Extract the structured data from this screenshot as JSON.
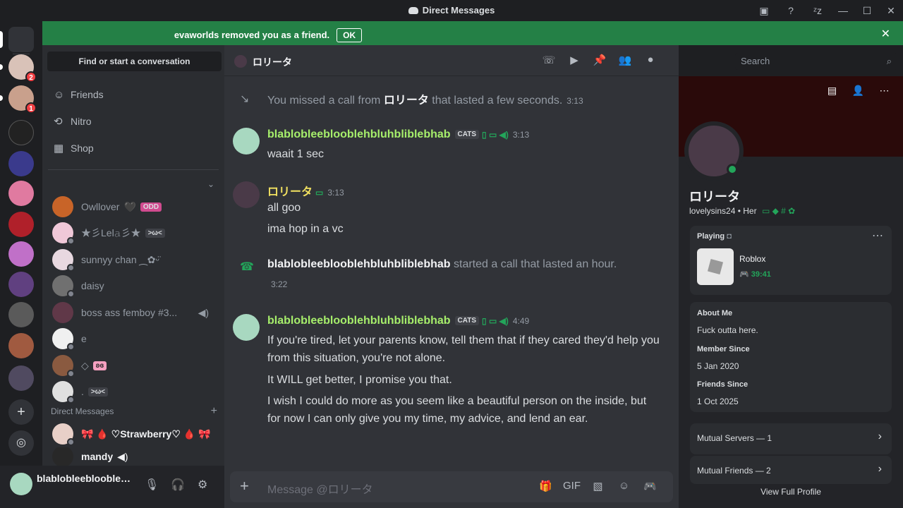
{
  "window": {
    "title": "Direct Messages",
    "controls": [
      "inbox-icon",
      "help-icon",
      "user-status-icon",
      "minimize-icon",
      "maximize-icon",
      "close-icon"
    ]
  },
  "banner": {
    "message": "evaworlds removed you as a friend.",
    "ok_label": "OK",
    "close_icon": "close-icon",
    "color": "#248046"
  },
  "server_rail": {
    "badges": [
      {
        "count": "2"
      },
      {
        "count": "1"
      }
    ]
  },
  "sidebar": {
    "find_label": "Find or start a conversation",
    "nav": [
      {
        "label": "Friends",
        "icon": "friends-icon"
      },
      {
        "label": "Nitro",
        "icon": "nitro-icon"
      },
      {
        "label": "Shop",
        "icon": "shop-icon"
      }
    ],
    "dms_top": [
      {
        "name": "Owllover",
        "extra": "🖤",
        "tag": "ODD"
      },
      {
        "name": "★彡Lel𝚊彡★",
        "extra": "",
        "tag": ">ω<"
      },
      {
        "name": "sunnyy chan ⁔✿ᵕ̈",
        "extra": "",
        "tag": ""
      },
      {
        "name": "daisy",
        "extra": "",
        "tag": ""
      },
      {
        "name": "boss ass femboy #3...",
        "extra": "",
        "tag": ""
      },
      {
        "name": "e",
        "extra": "",
        "tag": ""
      },
      {
        "name": "◇",
        "extra": "",
        "tag": "ʚɞ"
      },
      {
        "name": ".",
        "extra": "",
        "tag": ">ω<"
      }
    ],
    "section_label": "Direct Messages",
    "dms_bottom": [
      {
        "name": "🎀 🩸 ♡Strawberry♡ 🩸 🎀"
      },
      {
        "name": "mandy"
      }
    ]
  },
  "user_panel": {
    "username": "blablobleeblooblehbluhbliblebhab"
  },
  "chat": {
    "recipient": "ロリータ",
    "header_icons": [
      "voice-call-icon",
      "video-call-icon",
      "pinned-icon",
      "add-friend-icon",
      "user-profile-icon"
    ],
    "search_placeholder": "Search",
    "messages": {
      "missed_call": {
        "prefix": "You missed a call from",
        "name": "ロリータ",
        "suffix": "that lasted a few seconds.",
        "time": "3:13"
      },
      "m1": {
        "author": "blablobleeblooblehbluhbliblebhab",
        "tag": "CATS",
        "time": "3:13",
        "lines": [
          "waait 1 sec"
        ]
      },
      "m2": {
        "author": "ロリータ",
        "time": "3:13",
        "lines": [
          "all goo",
          "ima hop in a vc"
        ]
      },
      "call": {
        "name": "blablobleeblooblehbluhbliblebhab",
        "text": "started a call that lasted an hour.",
        "time": "3:22"
      },
      "m3": {
        "author": "blablobleeblooblehbluhbliblebhab",
        "tag": "CATS",
        "time": "4:49",
        "lines": [
          "If you're tired, let your parents know, tell them that if they cared they'd help you from this situation, you're not alone.",
          "It WILL get better, I promise you that.",
          "I wish I could do more as you seem like a beautiful person on the inside, but for now I can only give you my time, my advice, and lend an ear."
        ]
      }
    },
    "composer_placeholder": "Message @ロリータ",
    "composer_tools": [
      "gift-icon",
      "gif-icon",
      "sticker-icon",
      "emoji-icon",
      "activity-icon"
    ]
  },
  "profile": {
    "display_name": "ロリータ",
    "username": "lovelysins24",
    "pronouns": "Her",
    "activity": {
      "heading": "Playing",
      "game": "Roblox",
      "elapsed": "39:41"
    },
    "about_me_heading": "About Me",
    "about_me": "Fuck outta here.",
    "member_since_heading": "Member Since",
    "member_since": "5 Jan 2020",
    "friends_since_heading": "Friends Since",
    "friends_since": "1 Oct 2025",
    "mutual_servers": "Mutual Servers — 1",
    "mutual_friends": "Mutual Friends — 2",
    "view_full": "View Full Profile"
  },
  "colors": {
    "author_green": "#a6ee6b",
    "author_yellow": "#f0e060",
    "online": "#23a55a"
  }
}
